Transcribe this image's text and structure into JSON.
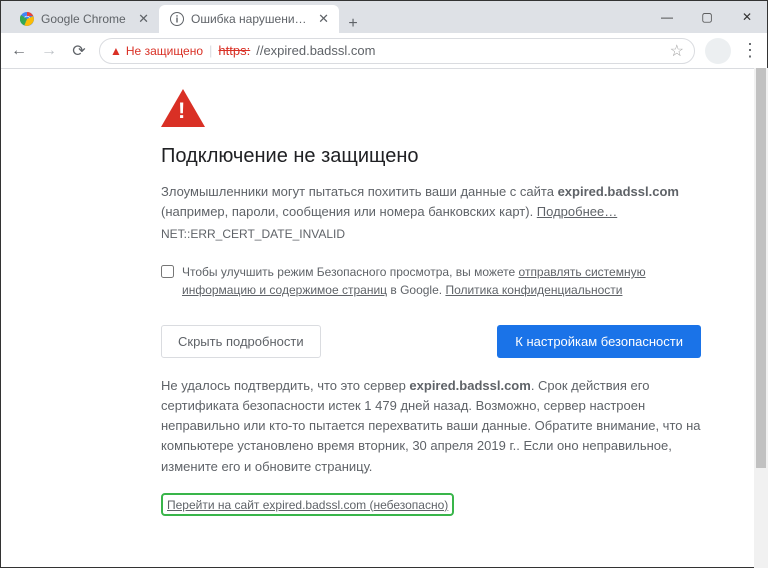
{
  "tabs": [
    {
      "title": "Google Chrome",
      "active": false
    },
    {
      "title": "Ошибка нарушения конфиденц...",
      "active": true
    }
  ],
  "toolbar": {
    "security_label": "Не защищено",
    "url_scheme": "https:",
    "url_rest": "//expired.badssl.com"
  },
  "page": {
    "heading": "Подключение не защищено",
    "body_1a": "Злоумышленники могут пытаться похитить ваши данные с сайта ",
    "body_1_host": "expired.badssl.com",
    "body_1b": " (например, пароли, сообщения или номера банковских карт). ",
    "learn_more": "Подробнее…",
    "error_code": "NET::ERR_CERT_DATE_INVALID",
    "optin_1": "Чтобы улучшить режим Безопасного просмотра, вы можете ",
    "optin_link1": "отправлять системную информацию и содержимое страниц",
    "optin_2": " в Google. ",
    "optin_link2": "Политика конфиденциальности",
    "hide_details": "Скрыть подробности",
    "to_settings": "К настройкам безопасности",
    "details_1a": "Не удалось подтвердить, что это сервер ",
    "details_host": "expired.badssl.com",
    "details_1b": ". Срок действия его сертификата безопасности истек 1 479 дней назад. Возможно, сервер настроен неправильно или кто-то пытается перехватить ваши данные. Обратите внимание, что на компьютере установлено время вторник, 30 апреля 2019 г.. Если оно неправильное, измените его и обновите страницу.",
    "proceed": "Перейти на сайт expired.badssl.com (небезопасно)"
  }
}
